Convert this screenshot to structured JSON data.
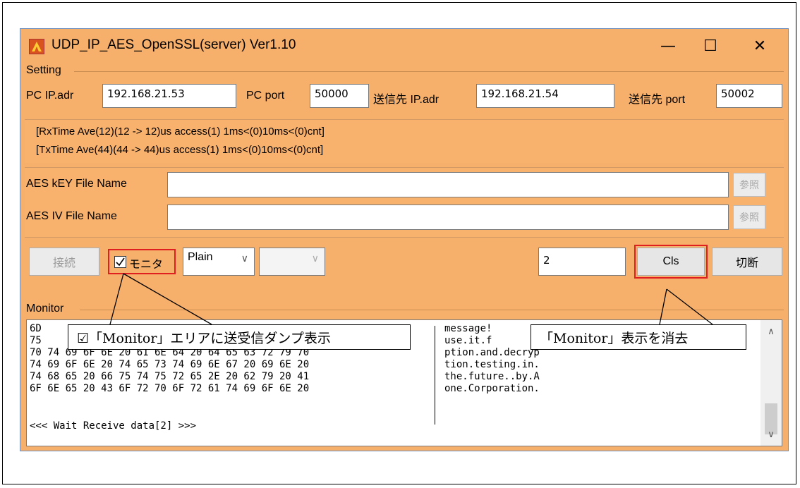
{
  "window": {
    "title": "UDP_IP_AES_OpenSSL(server) Ver1.10",
    "icons": {
      "app": "app-icon",
      "minimize": "minimize-icon",
      "maximize": "maximize-icon",
      "close": "close-icon"
    },
    "glyphs": {
      "minimize": "—",
      "maximize": "☐",
      "close": "✕"
    }
  },
  "setting": {
    "group_label": "Setting",
    "pc_ip_label": "PC IP.adr",
    "pc_ip_value": "192.168.21.53",
    "pc_port_label": "PC port",
    "pc_port_value": "50000",
    "dest_ip_label": "送信先 IP.adr",
    "dest_ip_value": "192.168.21.54",
    "dest_port_label": "送信先 port",
    "dest_port_value": "50002"
  },
  "stats": {
    "rx": "[RxTime Ave(12)(12 -> 12)us access(1) 1ms<(0)10ms<(0)cnt]",
    "tx": "[TxTime Ave(44)(44 -> 44)us access(1) 1ms<(0)10ms<(0)cnt]"
  },
  "aes": {
    "key_label": "AES kEY File Name",
    "key_value": "",
    "iv_label": "AES IV File Name",
    "iv_value": "",
    "ref_label": "参照"
  },
  "controls": {
    "connect_label": "接続",
    "monitor_check_label": "モニタ",
    "monitor_checked": true,
    "mode_value": "Plain",
    "mode2_value": "",
    "count_value": "2",
    "cls_label": "Cls",
    "disconnect_label": "切断"
  },
  "monitor": {
    "group_label": "Monitor",
    "hex_lines": [
      "6D",
      "75",
      "70 74 69 6F 6E 20 61 6E 64 20 64 65 63 72 79 70",
      "74 69 6F 6E 20 74 65 73 74 69 6E 67 20 69 6E 20",
      "74 68 65 20 66 75 74 75 72 65 2E 20 62 79 20 41",
      "6F 6E 65 20 43 6F 72 70 6F 72 61 74 69 6F 6E 20"
    ],
    "ascii_lines": [
      "message!",
      "use.it.f",
      "ption.and.decryp",
      "tion.testing.in.",
      "the.future..by.A",
      "one.Corporation."
    ],
    "wait_text": "<<< Wait Receive data[2] >>>"
  },
  "annotations": {
    "monitor_dump": "☑「Monitor」エリアに送受信ダンプ表示",
    "clear_monitor": "「Monitor」表示を消去"
  },
  "colors": {
    "panel": "#f7b06c",
    "highlight": "#e02020"
  }
}
